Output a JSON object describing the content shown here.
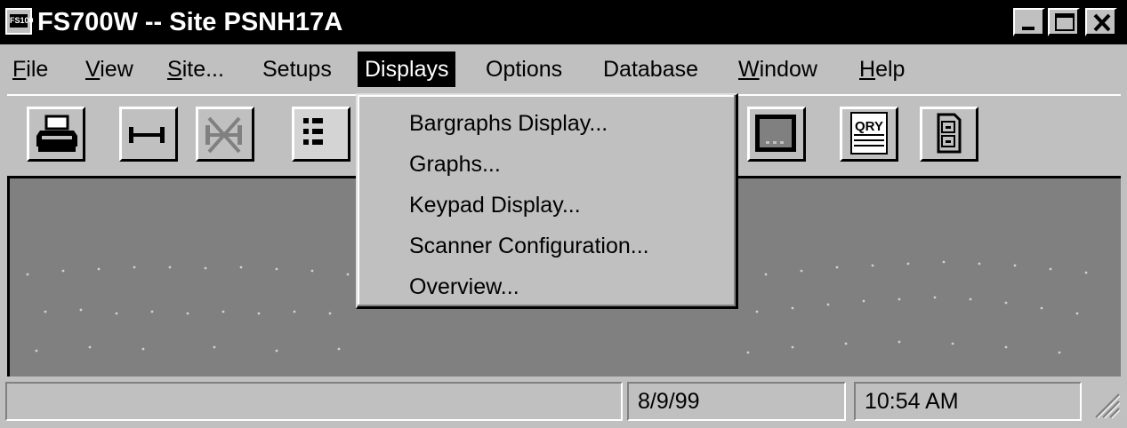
{
  "window": {
    "title": "FS700W -- Site PSNH17A",
    "app_icon_text": "FS100"
  },
  "menubar": {
    "items": [
      {
        "id": "file",
        "pre": "",
        "ul": "F",
        "post": "ile"
      },
      {
        "id": "view",
        "pre": "",
        "ul": "V",
        "post": "iew"
      },
      {
        "id": "site",
        "pre": "",
        "ul": "S",
        "post": "ite..."
      },
      {
        "id": "setups",
        "pre": "Setups",
        "ul": "",
        "post": ""
      },
      {
        "id": "displays",
        "pre": "Displays",
        "ul": "",
        "post": ""
      },
      {
        "id": "options",
        "pre": "Options",
        "ul": "",
        "post": ""
      },
      {
        "id": "database",
        "pre": "Database",
        "ul": "",
        "post": ""
      },
      {
        "id": "window",
        "pre": "",
        "ul": "W",
        "post": "indow"
      },
      {
        "id": "help",
        "pre": "",
        "ul": "H",
        "post": "elp"
      }
    ],
    "active": "Displays"
  },
  "toolbar": {
    "buttons": [
      "printer-icon",
      "connect-icon",
      "disconnect-icon",
      "list-icon",
      "display-icon",
      "query-icon",
      "file-cabinet-icon"
    ],
    "query_label": "QRY"
  },
  "dropdown": {
    "items": [
      "Bargraphs Display...",
      "Graphs...",
      "Keypad Display...",
      "Scanner Configuration...",
      "Overview..."
    ]
  },
  "statusbar": {
    "message": "",
    "date": "8/9/99",
    "time": "10:54 AM"
  }
}
